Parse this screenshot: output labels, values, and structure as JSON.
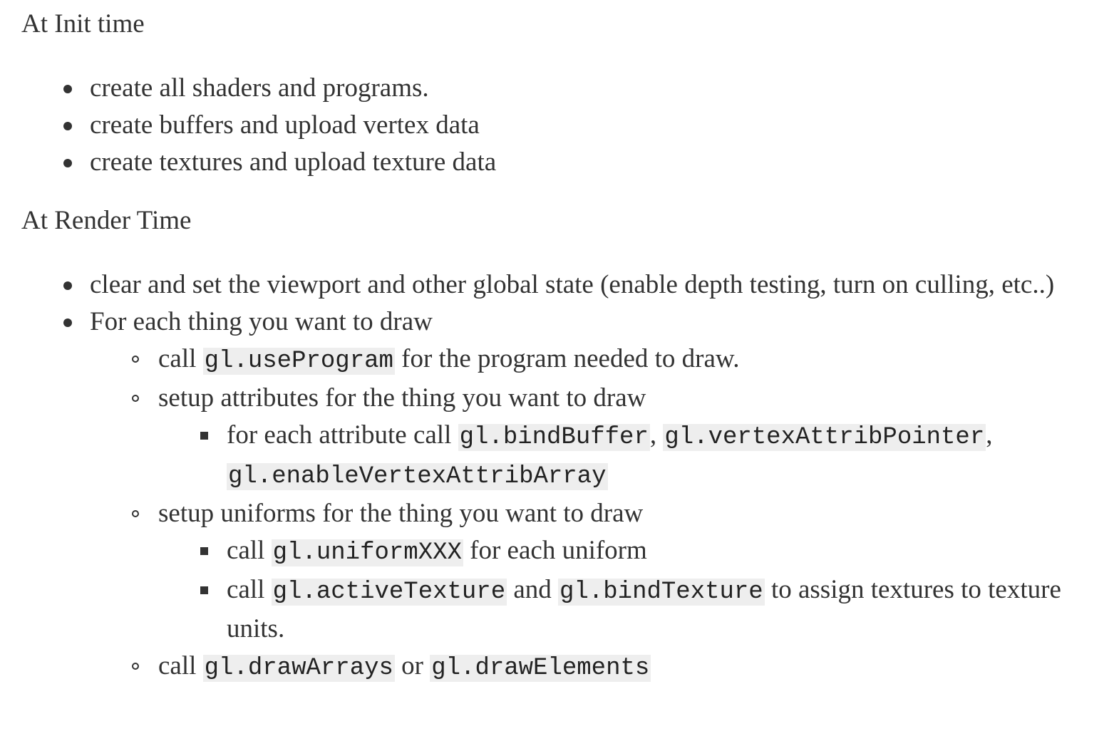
{
  "init": {
    "heading": "At Init time",
    "items": [
      "create all shaders and programs.",
      "create buffers and upload vertex data",
      "create textures and upload texture data"
    ]
  },
  "render": {
    "heading": "At Render Time",
    "item1": "clear and set the viewport and other global state (enable depth testing, turn on culling, etc..)",
    "item2": "For each thing you want to draw",
    "sub": {
      "use_program": {
        "prefix": "call ",
        "code": "gl.useProgram",
        "suffix": " for the program needed to draw."
      },
      "attributes": {
        "text": "setup attributes for the thing you want to draw",
        "sub_prefix": "for each attribute call ",
        "code1": "gl.bindBuffer",
        "sep1": ", ",
        "code2": "gl.vertexAttribPointer",
        "sep2": ", ",
        "code3": "gl.enableVertexAttribArray"
      },
      "uniforms": {
        "text": "setup uniforms for the thing you want to draw",
        "u1_prefix": "call ",
        "u1_code": "gl.uniformXXX",
        "u1_suffix": " for each uniform",
        "u2_prefix": "call ",
        "u2_code1": "gl.activeTexture",
        "u2_mid": " and ",
        "u2_code2": "gl.bindTexture",
        "u2_suffix": " to assign textures to texture units."
      },
      "draw": {
        "prefix": "call ",
        "code1": "gl.drawArrays",
        "mid": " or ",
        "code2": "gl.drawElements"
      }
    }
  }
}
